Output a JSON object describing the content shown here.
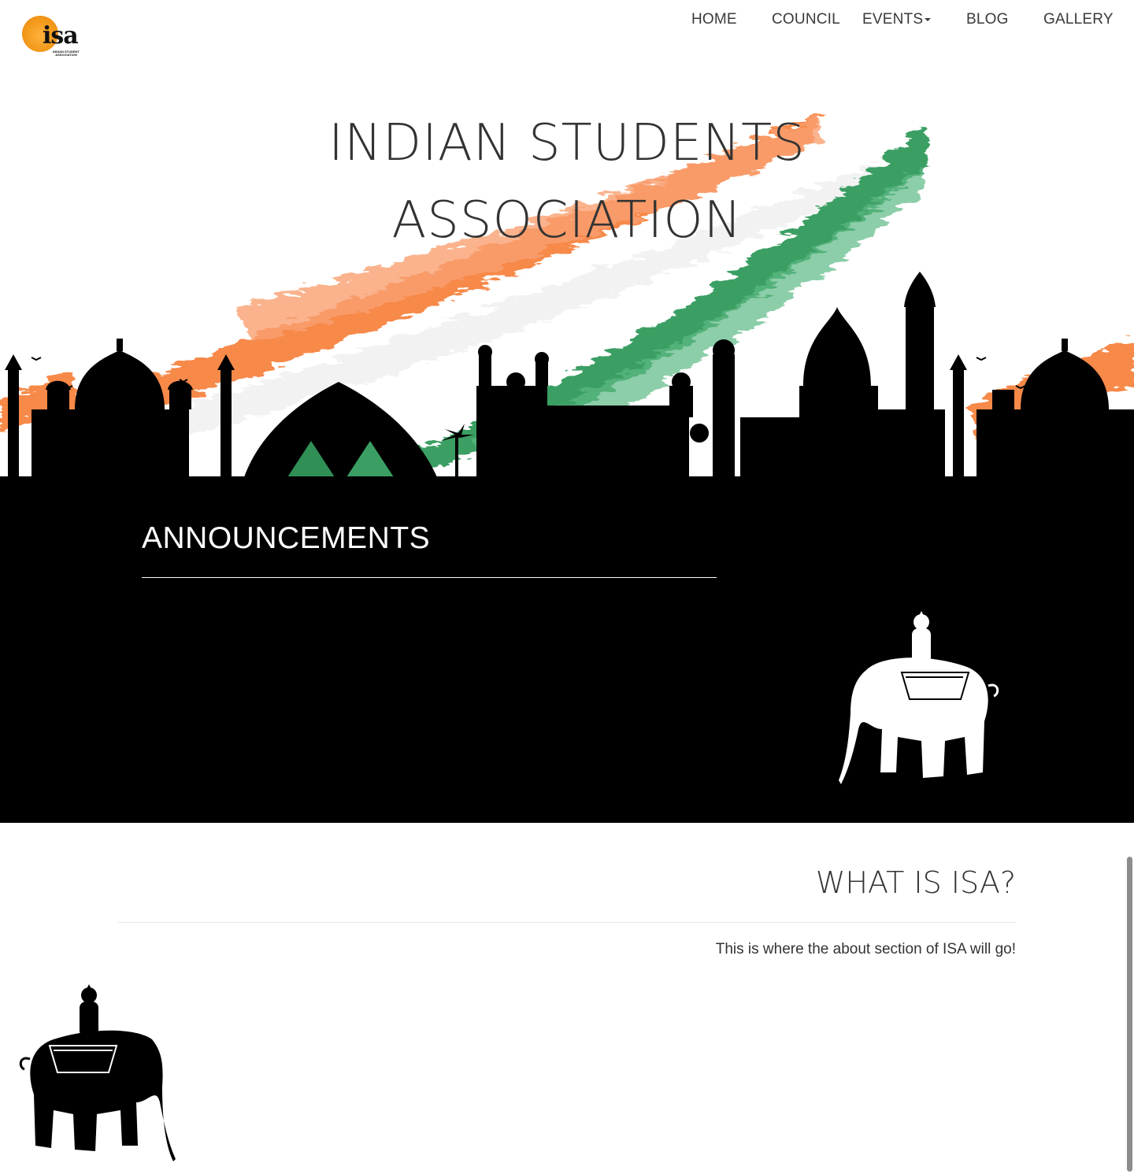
{
  "logo": {
    "text": "isa",
    "subtitle": "INDIAN STUDENT ASSOCIATION"
  },
  "nav": {
    "home": "HOME",
    "council": "COUNCIL",
    "events": "EVENTS",
    "blog": "BLOG",
    "gallery": "GALLERY"
  },
  "hero": {
    "title_line1": "INDIAN STUDENTS",
    "title_line2": "ASSOCIATION"
  },
  "announcements": {
    "title": "ANNOUNCEMENTS"
  },
  "about": {
    "title": "WHAT IS ISA?",
    "body": "This is where the about section of ISA will go!"
  },
  "colors": {
    "saffron": "#f7894a",
    "green": "#3b9f63",
    "silhouette": "#000000",
    "logo_orange": "#f39a1c"
  }
}
